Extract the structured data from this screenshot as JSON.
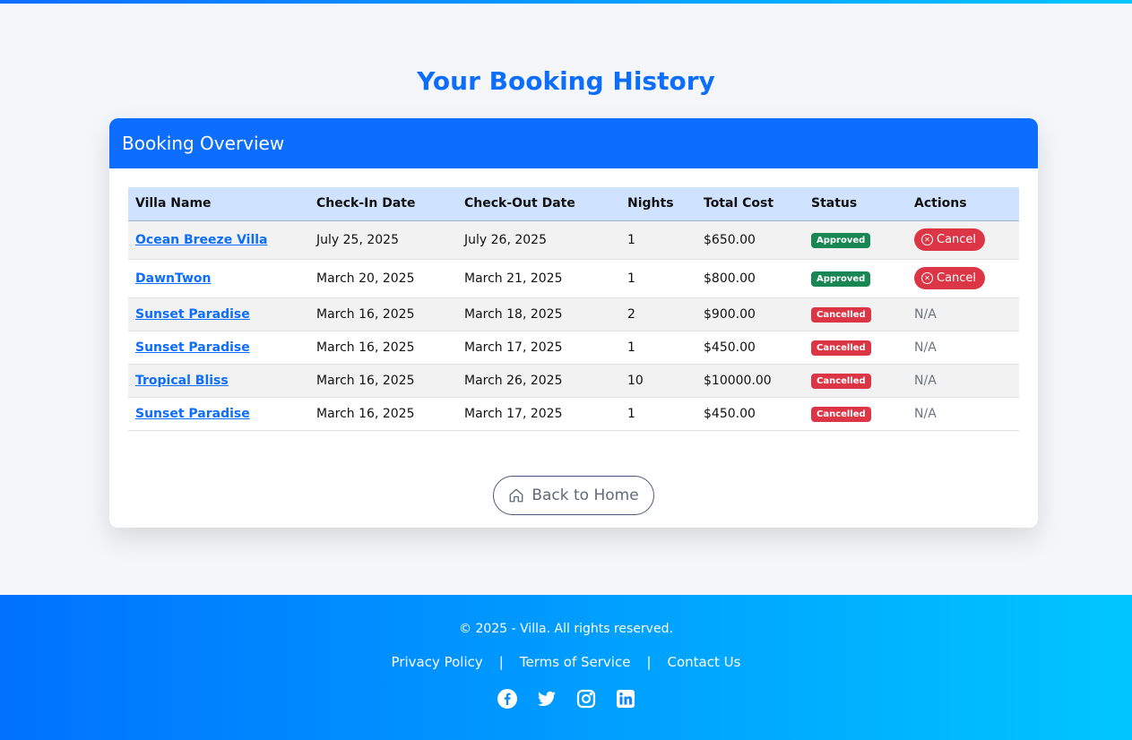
{
  "page": {
    "title": "Your Booking History"
  },
  "card": {
    "header": "Booking Overview"
  },
  "table": {
    "headers": [
      "Villa Name",
      "Check-In Date",
      "Check-Out Date",
      "Nights",
      "Total Cost",
      "Status",
      "Actions"
    ],
    "rows": [
      {
        "villa": "Ocean Breeze Villa",
        "check_in": "July 25, 2025",
        "check_out": "July 26, 2025",
        "nights": "1",
        "cost": "$650.00",
        "status": "Approved",
        "action": "Cancel"
      },
      {
        "villa": "DawnTwon",
        "check_in": "March 20, 2025",
        "check_out": "March 21, 2025",
        "nights": "1",
        "cost": "$800.00",
        "status": "Approved",
        "action": "Cancel"
      },
      {
        "villa": "Sunset Paradise",
        "check_in": "March 16, 2025",
        "check_out": "March 18, 2025",
        "nights": "2",
        "cost": "$900.00",
        "status": "Cancelled",
        "action": "N/A"
      },
      {
        "villa": "Sunset Paradise",
        "check_in": "March 16, 2025",
        "check_out": "March 17, 2025",
        "nights": "1",
        "cost": "$450.00",
        "status": "Cancelled",
        "action": "N/A"
      },
      {
        "villa": "Tropical Bliss",
        "check_in": "March 16, 2025",
        "check_out": "March 26, 2025",
        "nights": "10",
        "cost": "$10000.00",
        "status": "Cancelled",
        "action": "N/A"
      },
      {
        "villa": "Sunset Paradise",
        "check_in": "March 16, 2025",
        "check_out": "March 17, 2025",
        "nights": "1",
        "cost": "$450.00",
        "status": "Cancelled",
        "action": "N/A"
      }
    ]
  },
  "back_button": {
    "label": "Back to Home",
    "icon": "home-icon"
  },
  "footer": {
    "copyright": "© 2025 - Villa. All rights reserved.",
    "links": [
      "Privacy Policy",
      "Terms of Service",
      "Contact Us"
    ],
    "separator": "|",
    "social": [
      "facebook-icon",
      "twitter-icon",
      "instagram-icon",
      "linkedin-icon"
    ]
  },
  "colors": {
    "primary": "#0d6efd",
    "approved": "#198754",
    "cancelled": "#dc3545",
    "header_row": "#cfe2ff"
  }
}
